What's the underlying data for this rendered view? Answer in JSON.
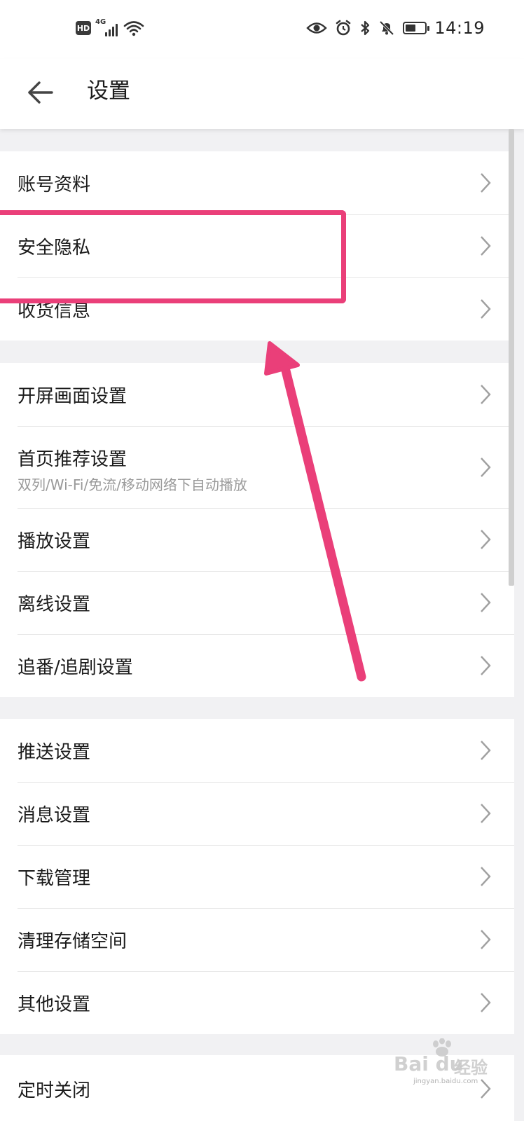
{
  "status_bar": {
    "hd_badge": "HD",
    "network": "4G",
    "time": "14:19",
    "battery_level": 0.55
  },
  "header": {
    "title": "设置"
  },
  "groups": [
    {
      "items": [
        {
          "label": "账号资料"
        },
        {
          "label": "安全隐私"
        },
        {
          "label": "收货信息"
        }
      ]
    },
    {
      "items": [
        {
          "label": "开屏画面设置"
        },
        {
          "label": "首页推荐设置",
          "sub": "双列/Wi-Fi/免流/移动网络下自动播放"
        },
        {
          "label": "播放设置"
        },
        {
          "label": "离线设置"
        },
        {
          "label": "追番/追剧设置"
        }
      ]
    },
    {
      "items": [
        {
          "label": "推送设置"
        },
        {
          "label": "消息设置"
        },
        {
          "label": "下载管理"
        },
        {
          "label": "清理存储空间"
        },
        {
          "label": "其他设置"
        }
      ]
    },
    {
      "items": [
        {
          "label": "定时关闭"
        }
      ]
    }
  ],
  "annotation": {
    "color": "#ea3f79",
    "highlighted_item": "安全隐私"
  },
  "watermark": {
    "text_brand": "Bai du",
    "text_cn": "经验",
    "text_url": "jingyan.baidu.com"
  }
}
